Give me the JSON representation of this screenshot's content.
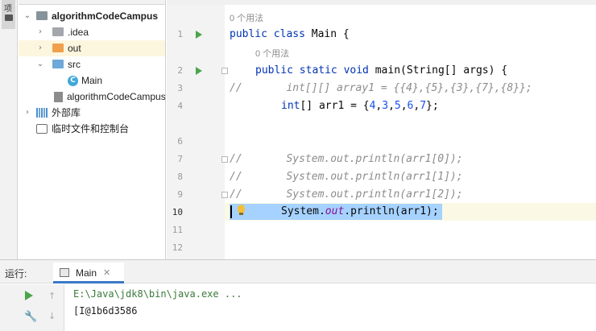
{
  "left_strip": {
    "tab_label": "项"
  },
  "project_tree": {
    "items": [
      {
        "label": "algorithmCodeCampus",
        "icon": "module-folder-icon",
        "expanded": true
      },
      {
        "label": ".idea",
        "icon": "folder-icon",
        "expanded": false
      },
      {
        "label": "out",
        "icon": "excluded-folder-icon",
        "expanded": false
      },
      {
        "label": "src",
        "icon": "source-folder-icon",
        "expanded": true
      },
      {
        "label": "Main",
        "icon": "java-class-icon"
      },
      {
        "label": "algorithmCodeCampus.iml",
        "icon": "iml-file-icon"
      },
      {
        "label": "外部库",
        "icon": "library-icon",
        "expanded": false
      },
      {
        "label": "临时文件和控制台",
        "icon": "scratch-icon"
      }
    ]
  },
  "editor": {
    "usage_hint_class": "0 个用法",
    "usage_hint_method": "0 个用法",
    "line_numbers": [
      "1",
      "2",
      "3",
      "4",
      "6",
      "7",
      "8",
      "9",
      "10",
      "11",
      "12"
    ],
    "code": {
      "l1_kw": "public class",
      "l1_rest": " Main {",
      "l2_kw": "public static void",
      "l2_rest": " main(String[] args) {",
      "l3": "//       int[][] array1 = {{4},{5},{3},{7},{8}};",
      "l4_type": "int",
      "l4_mid": "[] arr1 = {",
      "l4_n1": "4",
      "l4_n2": "3",
      "l4_n3": "5",
      "l4_n4": "6",
      "l4_n5": "7",
      "l4_end": "};",
      "l7": "//       System.out.println(arr1[0]);",
      "l8": "//       System.out.println(arr1[1]);",
      "l9": "//       System.out.println(arr1[2]);",
      "l10_a": "System.",
      "l10_out": "out",
      "l10_b": ".println(arr1);"
    }
  },
  "run_panel": {
    "title": "运行:",
    "tab_label": "Main",
    "command_line": "E:\\Java\\jdk8\\bin\\java.exe ...",
    "output": "[I@1b6d3586"
  },
  "colors": {
    "keyword": "#0033b3",
    "number": "#1750eb",
    "comment": "#8c8c8c",
    "static_field": "#871094",
    "selection": "#a6d2ff",
    "run_green": "#4aa54a"
  }
}
